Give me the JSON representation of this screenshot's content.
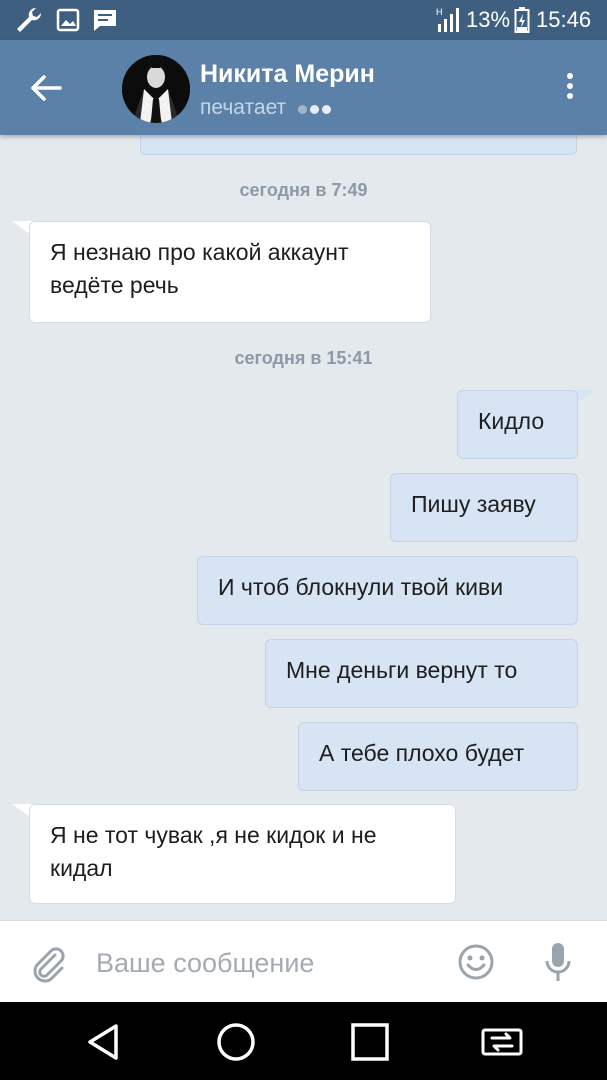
{
  "status_bar": {
    "battery_percent": "13%",
    "time": "15:46",
    "icons": [
      "wrench-icon",
      "image-notification-icon",
      "message-notification-icon",
      "signal-icon",
      "battery-icon"
    ]
  },
  "header": {
    "contact_name": "Никита Мерин",
    "status_text": "печатает",
    "back_icon": "arrow-left-icon",
    "menu_icon": "more-vertical-icon"
  },
  "chat": {
    "date_separators": [
      "сегодня в 7:49",
      "сегодня в 15:41"
    ],
    "messages": [
      {
        "direction": "in",
        "lines": [
          "Я незнаю про какой аккаунт",
          "ведёте речь"
        ]
      },
      {
        "direction": "out",
        "lines": [
          "Кидло"
        ]
      },
      {
        "direction": "out",
        "lines": [
          "Пишу заяву"
        ]
      },
      {
        "direction": "out",
        "lines": [
          "И чтоб блокнули твой киви"
        ]
      },
      {
        "direction": "out",
        "lines": [
          "Мне деньги вернут то"
        ]
      },
      {
        "direction": "out",
        "lines": [
          "А тебе плохо будет"
        ]
      },
      {
        "direction": "in",
        "lines": [
          "Я не тот чувак ,я не кидок и не",
          "кидал"
        ]
      }
    ]
  },
  "input_bar": {
    "placeholder": "Ваше сообщение",
    "value": "",
    "icons": [
      "paperclip-icon",
      "emoji-icon",
      "microphone-icon"
    ]
  },
  "nav_bar": {
    "icons": [
      "back-triangle-icon",
      "home-circle-icon",
      "recents-square-icon",
      "screen-switch-icon"
    ]
  },
  "colors": {
    "status_bar": "#3f5f80",
    "header": "#5b81a8",
    "chat_background": "#e4e9ee",
    "incoming_bubble": "#ffffff",
    "outgoing_bubble": "#d6e4f4",
    "date_separator_text": "#8d99a6"
  }
}
